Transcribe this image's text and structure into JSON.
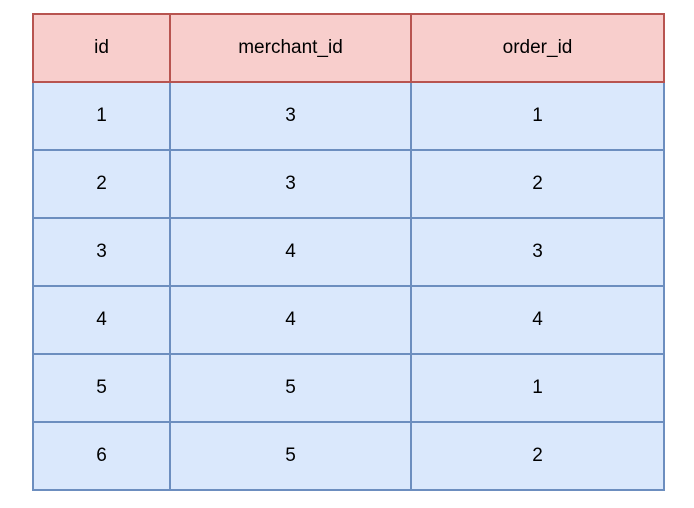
{
  "table": {
    "headers": [
      "id",
      "merchant_id",
      "order_id"
    ],
    "rows": [
      [
        "1",
        "3",
        "1"
      ],
      [
        "2",
        "3",
        "2"
      ],
      [
        "3",
        "4",
        "3"
      ],
      [
        "4",
        "4",
        "4"
      ],
      [
        "5",
        "5",
        "1"
      ],
      [
        "6",
        "5",
        "2"
      ]
    ]
  },
  "colors": {
    "header_fill": "#f8cecc",
    "header_border": "#b85450",
    "row_fill": "#dae8fc",
    "row_border": "#6c8ebf"
  }
}
